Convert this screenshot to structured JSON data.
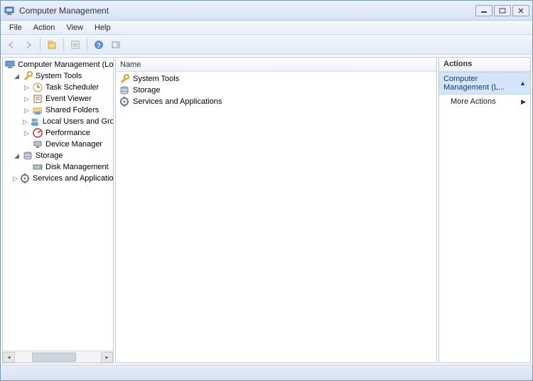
{
  "window": {
    "title": "Computer Management"
  },
  "menu": {
    "file": "File",
    "action": "Action",
    "view": "View",
    "help": "Help"
  },
  "tree": {
    "root": "Computer Management (Local",
    "system_tools": "System Tools",
    "task_scheduler": "Task Scheduler",
    "event_viewer": "Event Viewer",
    "shared_folders": "Shared Folders",
    "local_users": "Local Users and Groups",
    "performance": "Performance",
    "device_manager": "Device Manager",
    "storage": "Storage",
    "disk_management": "Disk Management",
    "services_apps": "Services and Applications"
  },
  "list": {
    "col_name": "Name",
    "items": {
      "system_tools": "System Tools",
      "storage": "Storage",
      "services_apps": "Services and Applications"
    }
  },
  "actions": {
    "header": "Actions",
    "selected": "Computer Management (L...",
    "more": "More Actions"
  }
}
